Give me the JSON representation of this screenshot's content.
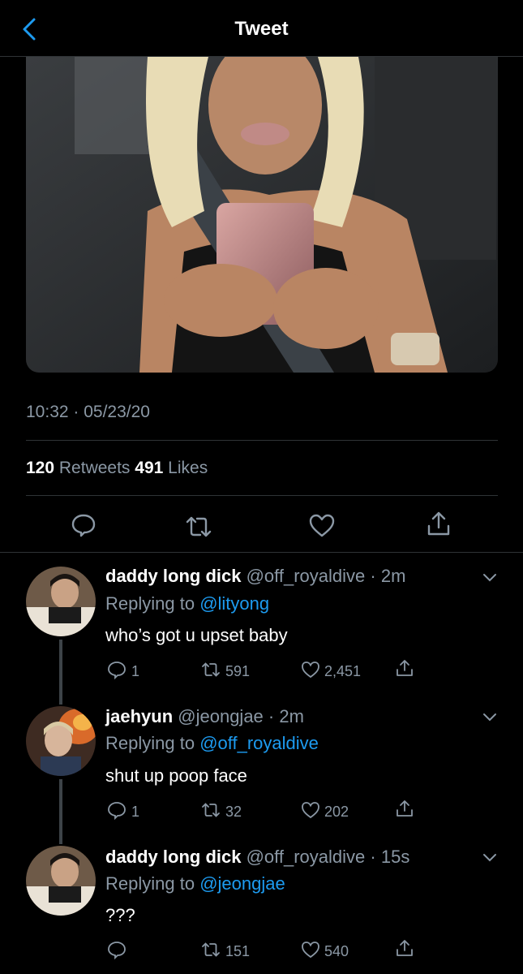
{
  "header": {
    "title": "Tweet"
  },
  "tweet": {
    "timestamp": "10:32 · 05/23/20",
    "retweets_count": "120",
    "retweets_label": "Retweets",
    "likes_count": "491",
    "likes_label": "Likes"
  },
  "replies": [
    {
      "name": "daddy long dick",
      "handle": "@off_royaldive",
      "time": "· 2m",
      "replying_prefix": "Replying to",
      "replying_to": "@lityong",
      "text": "who’s got u upset baby",
      "reply_count": "1",
      "retweet_count": "591",
      "like_count": "2,451"
    },
    {
      "name": "jaehyun",
      "handle": "@jeongjae",
      "time": "· 2m",
      "replying_prefix": "Replying to",
      "replying_to": "@off_royaldive",
      "text": "shut up poop face",
      "reply_count": "1",
      "retweet_count": "32",
      "like_count": "202"
    },
    {
      "name": "daddy long dick",
      "handle": "@off_royaldive",
      "time": "· 15s",
      "replying_prefix": "Replying to",
      "replying_to": "@jeongjae",
      "text": "???",
      "reply_count": "",
      "retweet_count": "151",
      "like_count": "540"
    }
  ],
  "colors": {
    "accent": "#1d9bf0",
    "muted": "#8b98a5",
    "background": "#000000"
  },
  "icons": [
    "back-chevron-icon",
    "reply-icon",
    "retweet-icon",
    "like-icon",
    "share-icon",
    "chevron-down-icon"
  ]
}
